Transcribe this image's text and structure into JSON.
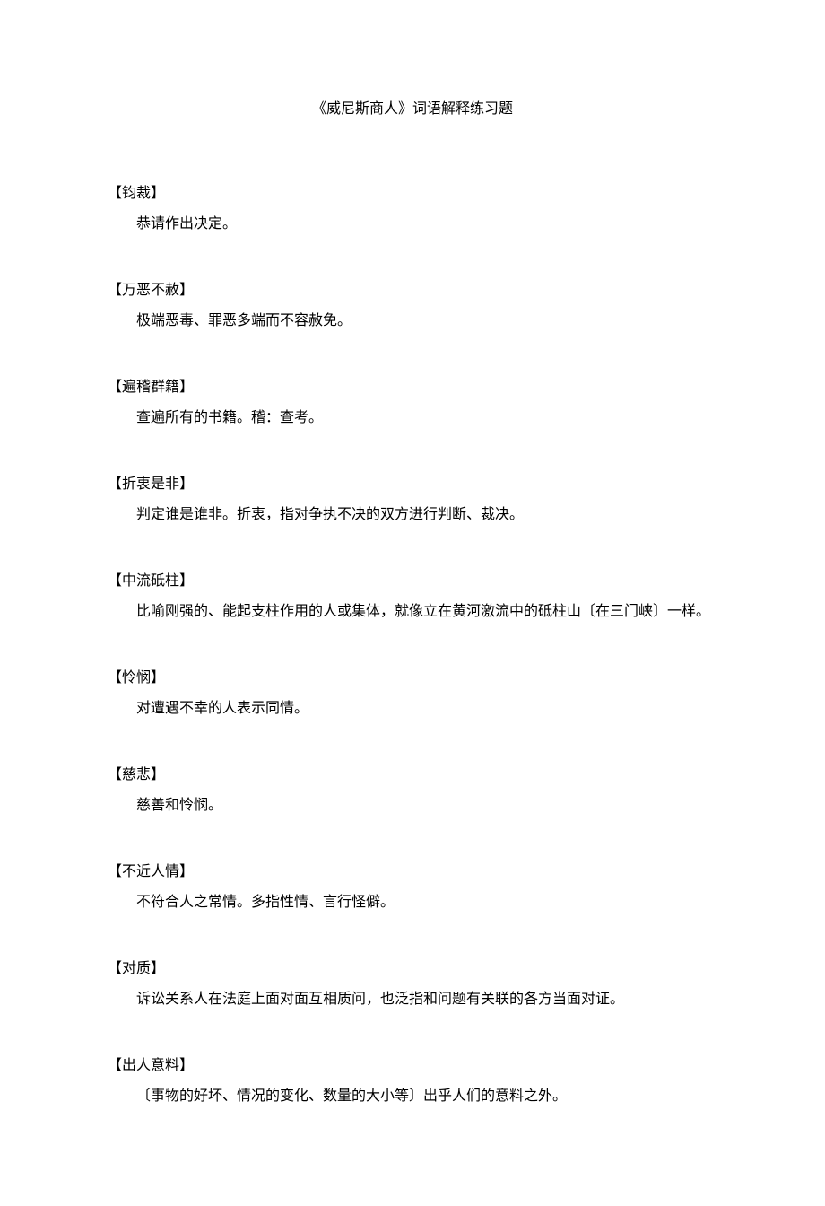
{
  "title": "《威尼斯商人》词语解释练习题",
  "entries": [
    {
      "term": "【钧裁】",
      "definition": "恭请作出决定。"
    },
    {
      "term": "【万恶不赦】",
      "definition": "极端恶毒、罪恶多端而不容赦免。"
    },
    {
      "term": "【遍稽群籍】",
      "definition": "查遍所有的书籍。稽：查考。"
    },
    {
      "term": "【折衷是非】",
      "definition": "判定谁是谁非。折衷，指对争执不决的双方进行判断、裁决。"
    },
    {
      "term": "【中流砥柱】",
      "definition": "比喻刚强的、能起支柱作用的人或集体，就像立在黄河激流中的砥柱山〔在三门峡〕一样。"
    },
    {
      "term": "【怜悯】",
      "definition": "对遭遇不幸的人表示同情。"
    },
    {
      "term": "【慈悲】",
      "definition": "慈善和怜悯。"
    },
    {
      "term": "【不近人情】",
      "definition": "不符合人之常情。多指性情、言行怪僻。"
    },
    {
      "term": "【对质】",
      "definition": "诉讼关系人在法庭上面对面互相质问，也泛指和问题有关联的各方当面对证。"
    },
    {
      "term": "【出人意料】",
      "definition": "〔事物的好坏、情况的变化、数量的大小等〕出乎人们的意料之外。"
    }
  ]
}
